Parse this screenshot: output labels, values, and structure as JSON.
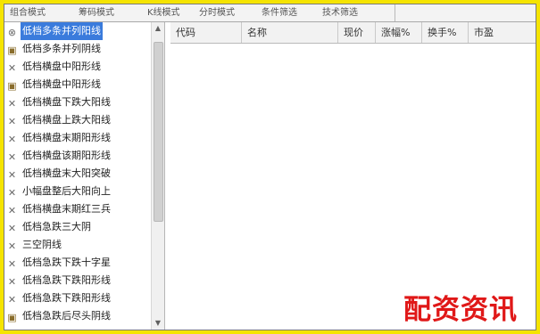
{
  "tabs": [
    "组合模式",
    "筹码模式",
    "K线模式",
    "分时模式",
    "条件筛选",
    "技术筛选"
  ],
  "tree": {
    "items": [
      {
        "label": "低档多条并列阳线",
        "icon": "close-icon",
        "selected": true
      },
      {
        "label": "低档多条并列阴线",
        "icon": "folder-icon",
        "selected": false
      },
      {
        "label": "低档横盘中阳形线",
        "icon": "close-icon",
        "selected": false
      },
      {
        "label": "低档横盘中阳形线",
        "icon": "folder-icon",
        "selected": false
      },
      {
        "label": "低档横盘下跌大阳线",
        "icon": "close-icon",
        "selected": false
      },
      {
        "label": "低档横盘上跌大阳线",
        "icon": "close-icon",
        "selected": false
      },
      {
        "label": "低档横盘末期阳形线",
        "icon": "close-icon",
        "selected": false
      },
      {
        "label": "低档横盘该期阳形线",
        "icon": "close-icon",
        "selected": false
      },
      {
        "label": "低档横盘末大阳突破",
        "icon": "close-icon",
        "selected": false
      },
      {
        "label": "小幅盘整后大阳向上",
        "icon": "close-icon",
        "selected": false
      },
      {
        "label": "低档横盘末期红三兵",
        "icon": "close-icon",
        "selected": false
      },
      {
        "label": "低档急跌三大阴",
        "icon": "close-icon",
        "selected": false
      },
      {
        "label": "三空阴线",
        "icon": "close-icon",
        "selected": false
      },
      {
        "label": "低档急跌下跌十字星",
        "icon": "close-icon",
        "selected": false
      },
      {
        "label": "低档急跌下跌阳形线",
        "icon": "close-icon",
        "selected": false
      },
      {
        "label": "低档急跌下跌阳形线",
        "icon": "close-icon",
        "selected": false
      },
      {
        "label": "低档急跌后尽头阴线",
        "icon": "folder-icon",
        "selected": false
      }
    ]
  },
  "grid": {
    "columns": [
      "代码",
      "名称",
      "现价",
      "涨幅%",
      "换手%",
      "市盈"
    ]
  },
  "watermark": "配资资讯",
  "colors": {
    "frame": "#f5e400",
    "selection": "#3a7bdc",
    "watermark": "#e01818"
  }
}
